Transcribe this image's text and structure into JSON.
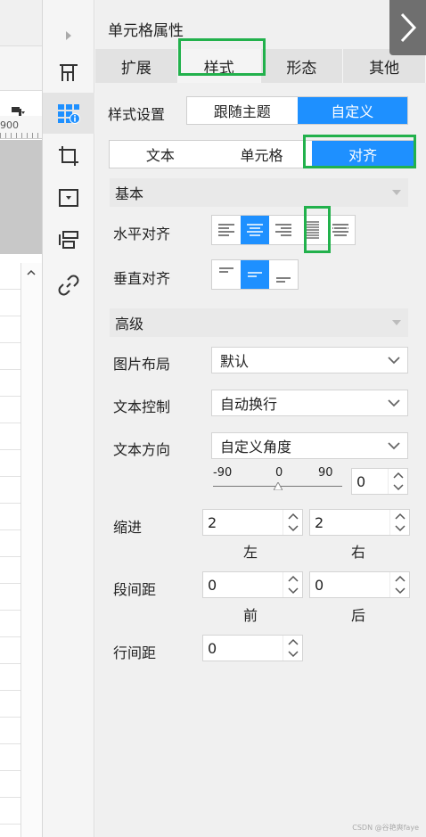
{
  "panel": {
    "title": "单元格属性",
    "tabs": [
      "扩展",
      "样式",
      "形态",
      "其他"
    ],
    "active_tab": "样式"
  },
  "style_settings": {
    "label": "样式设置",
    "options": [
      "跟随主题",
      "自定义"
    ],
    "selected": "自定义"
  },
  "subtabs": {
    "options": [
      "文本",
      "单元格",
      "对齐"
    ],
    "selected": "对齐"
  },
  "basic": {
    "title": "基本",
    "h_align_label": "水平对齐",
    "v_align_label": "垂直对齐",
    "h_align_icons": [
      "align-left-icon",
      "align-center-icon",
      "align-right-icon",
      "align-justify-icon",
      "align-distributed-icon"
    ],
    "h_align_selected_index": 1,
    "v_align_icons": [
      "align-top-icon",
      "align-middle-icon",
      "align-bottom-icon"
    ],
    "v_align_selected_index": 1
  },
  "advanced": {
    "title": "高级",
    "image_layout": {
      "label": "图片布局",
      "value": "默认"
    },
    "text_control": {
      "label": "文本控制",
      "value": "自动换行"
    },
    "text_direction": {
      "label": "文本方向",
      "value": "自定义角度"
    },
    "angle": {
      "min": "-90",
      "mid": "0",
      "max": "90",
      "value": "0"
    },
    "indent": {
      "label": "缩进",
      "left_value": "2",
      "right_value": "2",
      "left_label": "左",
      "right_label": "右"
    },
    "paragraph_spacing": {
      "label": "段间距",
      "before_value": "0",
      "after_value": "0",
      "before_label": "前",
      "after_label": "后"
    },
    "line_spacing": {
      "label": "行间距",
      "value": "0"
    }
  },
  "ruler": {
    "label": "900"
  },
  "watermark": "CSDN @谷艳爽faye",
  "colors": {
    "accent": "#1e90ff",
    "highlight": "#22b14c"
  }
}
